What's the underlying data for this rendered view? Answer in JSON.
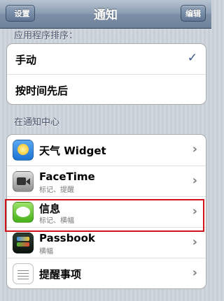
{
  "navbar": {
    "back_label": "设置",
    "title": "通知",
    "edit_label": "编辑"
  },
  "sort_section": {
    "header": "应用程序排序：",
    "options": [
      {
        "label": "手动",
        "selected": true
      },
      {
        "label": "按时间先后",
        "selected": false
      }
    ]
  },
  "center_section": {
    "header": "在通知中心",
    "apps": [
      {
        "name": "天气 Widget",
        "subtitle": "",
        "icon": "weather-icon"
      },
      {
        "name": "FaceTime",
        "subtitle": "标记、提醒",
        "icon": "facetime-icon"
      },
      {
        "name": "信息",
        "subtitle": "标记、横幅",
        "icon": "messages-icon"
      },
      {
        "name": "Passbook",
        "subtitle": "横幅",
        "icon": "passbook-icon"
      },
      {
        "name": "提醒事项",
        "subtitle": "",
        "icon": "reminders-icon"
      }
    ]
  },
  "colors": {
    "highlight": "#d3131c",
    "navbar": "#7c8fa6",
    "checkmark": "#385487"
  }
}
